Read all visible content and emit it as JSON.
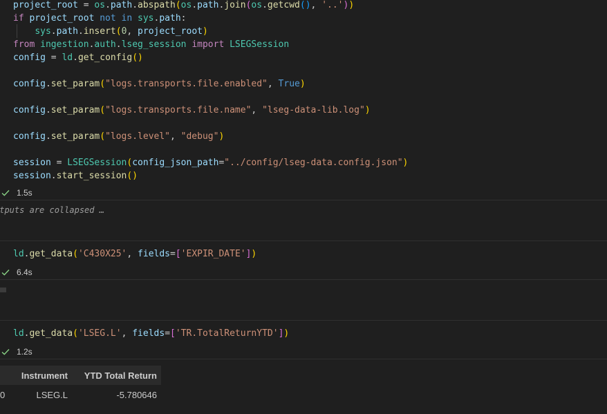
{
  "cell1": {
    "lines": [
      [
        [
          "var",
          "project_root"
        ],
        [
          "plain",
          " = "
        ],
        [
          "cls",
          "os"
        ],
        [
          "plain",
          "."
        ],
        [
          "var",
          "path"
        ],
        [
          "plain",
          "."
        ],
        [
          "fn",
          "abspath"
        ],
        [
          "p1",
          "("
        ],
        [
          "cls",
          "os"
        ],
        [
          "plain",
          "."
        ],
        [
          "var",
          "path"
        ],
        [
          "plain",
          "."
        ],
        [
          "fn",
          "join"
        ],
        [
          "p2",
          "("
        ],
        [
          "cls",
          "os"
        ],
        [
          "plain",
          "."
        ],
        [
          "fn",
          "getcwd"
        ],
        [
          "p3",
          "()"
        ],
        [
          "plain",
          ", "
        ],
        [
          "str",
          "'..'"
        ],
        [
          "p2",
          ")"
        ],
        [
          "p1",
          ")"
        ]
      ],
      [
        [
          "kw",
          "if"
        ],
        [
          "plain",
          " "
        ],
        [
          "var",
          "project_root"
        ],
        [
          "plain",
          " "
        ],
        [
          "kw2",
          "not"
        ],
        [
          "plain",
          " "
        ],
        [
          "kw2",
          "in"
        ],
        [
          "plain",
          " "
        ],
        [
          "cls",
          "sys"
        ],
        [
          "plain",
          "."
        ],
        [
          "var",
          "path"
        ],
        [
          "plain",
          ":"
        ]
      ],
      [
        [
          "plain",
          "    "
        ],
        [
          "cls",
          "sys"
        ],
        [
          "plain",
          "."
        ],
        [
          "var",
          "path"
        ],
        [
          "plain",
          "."
        ],
        [
          "fn",
          "insert"
        ],
        [
          "p1",
          "("
        ],
        [
          "num",
          "0"
        ],
        [
          "plain",
          ", "
        ],
        [
          "var",
          "project_root"
        ],
        [
          "p1",
          ")"
        ]
      ],
      [
        [
          "kw",
          "from"
        ],
        [
          "plain",
          " "
        ],
        [
          "cls",
          "ingestion"
        ],
        [
          "plain",
          "."
        ],
        [
          "cls",
          "auth"
        ],
        [
          "plain",
          "."
        ],
        [
          "cls",
          "lseg_session"
        ],
        [
          "plain",
          " "
        ],
        [
          "kw",
          "import"
        ],
        [
          "plain",
          " "
        ],
        [
          "cls",
          "LSEGSession"
        ]
      ],
      [
        [
          "var",
          "config"
        ],
        [
          "plain",
          " = "
        ],
        [
          "cls",
          "ld"
        ],
        [
          "plain",
          "."
        ],
        [
          "fn",
          "get_config"
        ],
        [
          "p1",
          "()"
        ]
      ],
      [],
      [
        [
          "var",
          "config"
        ],
        [
          "plain",
          "."
        ],
        [
          "fn",
          "set_param"
        ],
        [
          "p1",
          "("
        ],
        [
          "str",
          "\"logs.transports.file.enabled\""
        ],
        [
          "plain",
          ", "
        ],
        [
          "kw2",
          "True"
        ],
        [
          "p1",
          ")"
        ]
      ],
      [],
      [
        [
          "var",
          "config"
        ],
        [
          "plain",
          "."
        ],
        [
          "fn",
          "set_param"
        ],
        [
          "p1",
          "("
        ],
        [
          "str",
          "\"logs.transports.file.name\""
        ],
        [
          "plain",
          ", "
        ],
        [
          "str",
          "\"lseg-data-lib.log\""
        ],
        [
          "p1",
          ")"
        ]
      ],
      [],
      [
        [
          "var",
          "config"
        ],
        [
          "plain",
          "."
        ],
        [
          "fn",
          "set_param"
        ],
        [
          "p1",
          "("
        ],
        [
          "str",
          "\"logs.level\""
        ],
        [
          "plain",
          ", "
        ],
        [
          "str",
          "\"debug\""
        ],
        [
          "p1",
          ")"
        ]
      ],
      [],
      [
        [
          "var",
          "session"
        ],
        [
          "plain",
          " = "
        ],
        [
          "cls",
          "LSEGSession"
        ],
        [
          "p1",
          "("
        ],
        [
          "var",
          "config_json_path"
        ],
        [
          "plain",
          "="
        ],
        [
          "str",
          "\"../config/lseg-data.config.json\""
        ],
        [
          "p1",
          ")"
        ]
      ],
      [
        [
          "var",
          "session"
        ],
        [
          "plain",
          "."
        ],
        [
          "fn",
          "start_session"
        ],
        [
          "p1",
          "()"
        ]
      ]
    ],
    "duration": "1.5s",
    "collapsed_text": "utputs are collapsed …"
  },
  "cell2": {
    "lines": [
      [
        [
          "cls",
          "ld"
        ],
        [
          "plain",
          "."
        ],
        [
          "fn",
          "get_data"
        ],
        [
          "p1",
          "("
        ],
        [
          "str",
          "'C430X25'"
        ],
        [
          "plain",
          ", "
        ],
        [
          "var",
          "fields"
        ],
        [
          "plain",
          "="
        ],
        [
          "p2",
          "["
        ],
        [
          "str",
          "'EXPIR_DATE'"
        ],
        [
          "p2",
          "]"
        ],
        [
          "p1",
          ")"
        ]
      ]
    ],
    "duration": "6.4s"
  },
  "cell3": {
    "lines": [
      [
        [
          "cls",
          "ld"
        ],
        [
          "plain",
          "."
        ],
        [
          "fn",
          "get_data"
        ],
        [
          "p1",
          "("
        ],
        [
          "str",
          "'LSEG.L'"
        ],
        [
          "plain",
          ", "
        ],
        [
          "var",
          "fields"
        ],
        [
          "plain",
          "="
        ],
        [
          "p2",
          "["
        ],
        [
          "str",
          "'TR.TotalReturnYTD'"
        ],
        [
          "p2",
          "]"
        ],
        [
          "p1",
          ")"
        ]
      ]
    ],
    "duration": "1.2s",
    "table": {
      "columns": [
        "",
        "Instrument",
        "YTD Total Return"
      ],
      "rows": [
        [
          "0",
          "LSEG.L",
          "-5.780646"
        ]
      ]
    }
  },
  "colors": {
    "background": "#1f1f1f",
    "check": "#89d185",
    "string": "#ce9178",
    "keyword": "#c586c0",
    "function": "#dcdcaa"
  }
}
